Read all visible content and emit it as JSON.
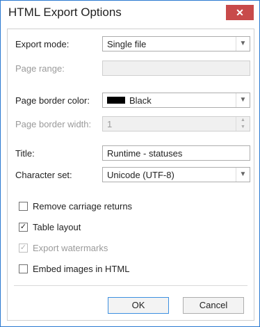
{
  "window": {
    "title": "HTML Export Options",
    "close_glyph": "✕"
  },
  "fields": {
    "export_mode": {
      "label": "Export mode:",
      "value": "Single file"
    },
    "page_range": {
      "label": "Page range:",
      "value": ""
    },
    "page_border_color": {
      "label": "Page border color:",
      "value": "Black",
      "swatch_color": "#000000"
    },
    "page_border_width": {
      "label": "Page border width:",
      "value": "1"
    },
    "title": {
      "label": "Title:",
      "value": "Runtime - statuses"
    },
    "character_set": {
      "label": "Character set:",
      "value": "Unicode (UTF-8)"
    }
  },
  "checkboxes": {
    "remove_carriage_returns": {
      "label": "Remove carriage returns",
      "checked": false
    },
    "table_layout": {
      "label": "Table layout",
      "checked": true
    },
    "export_watermarks": {
      "label": "Export watermarks",
      "checked": true,
      "disabled": true
    },
    "embed_images": {
      "label": "Embed images in HTML",
      "checked": false
    }
  },
  "buttons": {
    "ok": "OK",
    "cancel": "Cancel"
  },
  "glyphs": {
    "check": "✓",
    "dropdown": "▼",
    "spin_up": "▲",
    "spin_down": "▼"
  },
  "colors": {
    "close_bg": "#c84a4a",
    "window_border": "#2b79d0"
  }
}
